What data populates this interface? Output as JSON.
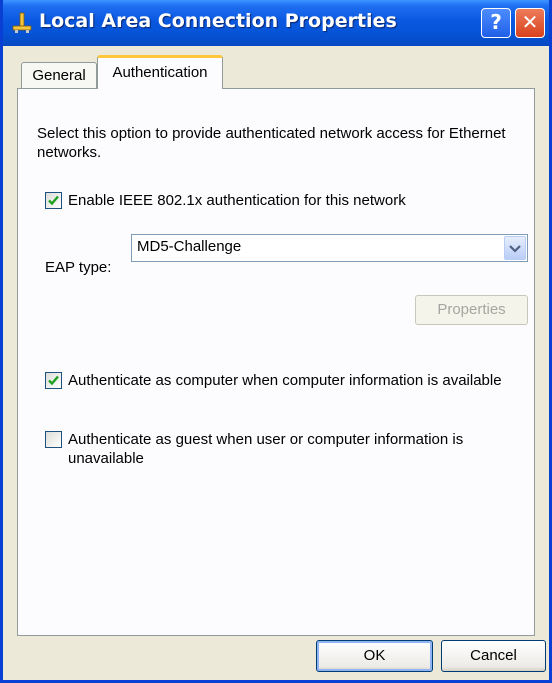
{
  "window": {
    "title": "Local Area Connection Properties",
    "help_label": "?",
    "close_label": "✕"
  },
  "tabs": [
    {
      "label": "General",
      "selected": false
    },
    {
      "label": "Authentication",
      "selected": true
    }
  ],
  "authentication": {
    "description": "Select this option to provide authenticated network access for Ethernet networks.",
    "enable_8021x": {
      "label": "Enable IEEE 802.1x authentication for this network",
      "checked": true
    },
    "eap_type": {
      "label": "EAP type:",
      "value": "MD5-Challenge"
    },
    "properties_label": "Properties",
    "auth_as_computer": {
      "label": "Authenticate as computer when computer information is available",
      "checked": true
    },
    "auth_as_guest": {
      "label": "Authenticate as guest when user or computer information is unavailable",
      "checked": false
    }
  },
  "buttons": {
    "ok_label": "OK",
    "cancel_label": "Cancel"
  },
  "colors": {
    "titlebar": "#0a58e0",
    "window_bg": "#ece9d8",
    "selected_tab_accent": "#ffc83c",
    "checkmark": "#21a121"
  },
  "icons": {
    "title": "network-connection-icon",
    "dropdown": "chevron-down-icon",
    "check": "checkmark-icon"
  }
}
